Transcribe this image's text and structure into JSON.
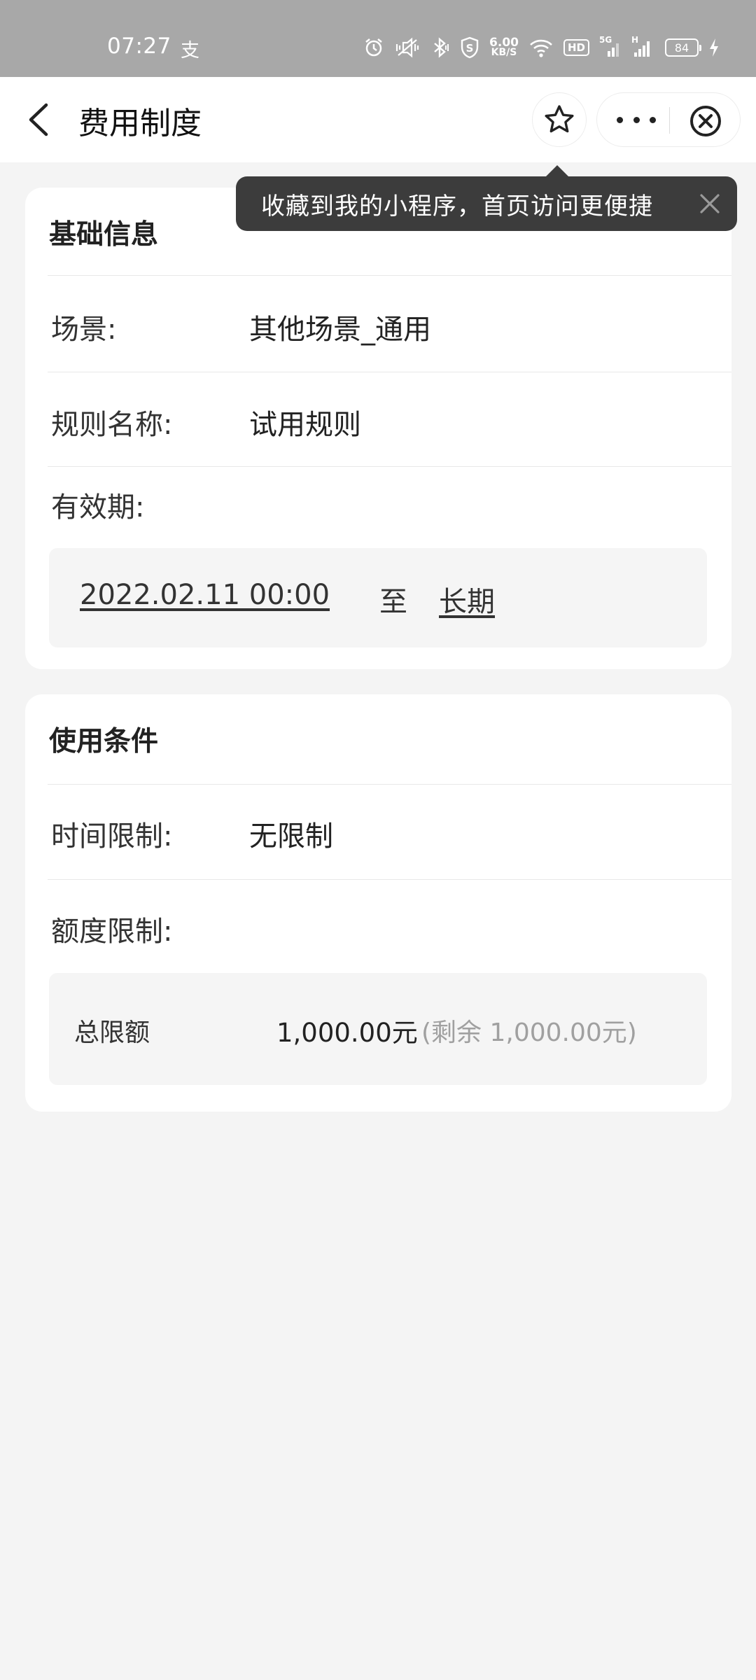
{
  "status_bar": {
    "time": "07:27",
    "alipay_glyph": "支",
    "net_speed_value": "6.00",
    "net_speed_unit": "KB/S",
    "hd_label": "HD",
    "sim1_label": "5G",
    "sim2_label": "H",
    "battery": "84"
  },
  "nav": {
    "title": "费用制度",
    "back_icon": "chevron-left-icon",
    "star_icon": "star-icon",
    "more_icon": "more-dots-icon",
    "close_icon": "close-circle-icon"
  },
  "tooltip": {
    "text": "收藏到我的小程序，首页访问更便捷"
  },
  "basic_info": {
    "title": "基础信息",
    "scene_label": "场景:",
    "scene_value": "其他场景_通用",
    "rule_label": "规则名称:",
    "rule_value": "试用规则",
    "validity_label": "有效期:",
    "validity_start": "2022.02.11 00:00",
    "validity_sep": "至",
    "validity_end": "长期"
  },
  "conditions": {
    "title": "使用条件",
    "time_label": "时间限制:",
    "time_value": "无限制",
    "quota_label": "额度限制:",
    "total_label": "总限额",
    "total_amount": "1,000.00元",
    "total_remaining": "(剩余 1,000.00元)"
  },
  "colors": {
    "status_bar_bg": "#a8a8a8",
    "page_bg": "#f4f4f4",
    "tooltip_bg": "#3c3c3c",
    "muted_text": "#a0a0a0"
  }
}
